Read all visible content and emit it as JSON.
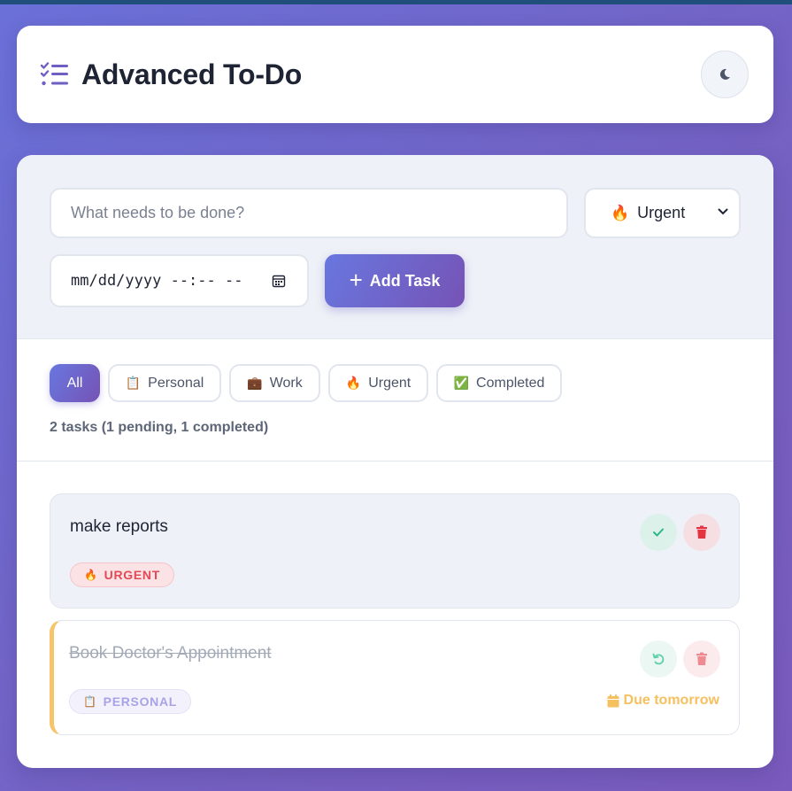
{
  "header": {
    "title": "Advanced To-Do",
    "logo_icon": "list-check-icon",
    "theme_toggle_icon": "moon-icon"
  },
  "form": {
    "task_placeholder": "What needs to be done?",
    "task_value": "",
    "priority": {
      "emoji": "🔥",
      "label": "Urgent"
    },
    "date_placeholder": "mm/dd/yyyy --:-- --",
    "add_label": "Add Task"
  },
  "filters": [
    {
      "label": "All",
      "emoji": "",
      "active": true
    },
    {
      "label": "Personal",
      "emoji": "📋",
      "active": false
    },
    {
      "label": "Work",
      "emoji": "💼",
      "active": false
    },
    {
      "label": "Urgent",
      "emoji": "🔥",
      "active": false
    },
    {
      "label": "Completed",
      "emoji": "✅",
      "active": false
    }
  ],
  "task_count": "2 tasks (1 pending, 1 completed)",
  "tasks": [
    {
      "title": "make reports",
      "category": "URGENT",
      "category_emoji": "🔥",
      "completed": false,
      "due": ""
    },
    {
      "title": "Book Doctor's Appointment",
      "category": "PERSONAL",
      "category_emoji": "📋",
      "completed": true,
      "due": "Due tomorrow"
    }
  ],
  "colors": {
    "accent_start": "#6877df",
    "accent_end": "#7653b5",
    "urgent": "#e14a56",
    "success": "#2bb886",
    "due": "#f5c060"
  }
}
